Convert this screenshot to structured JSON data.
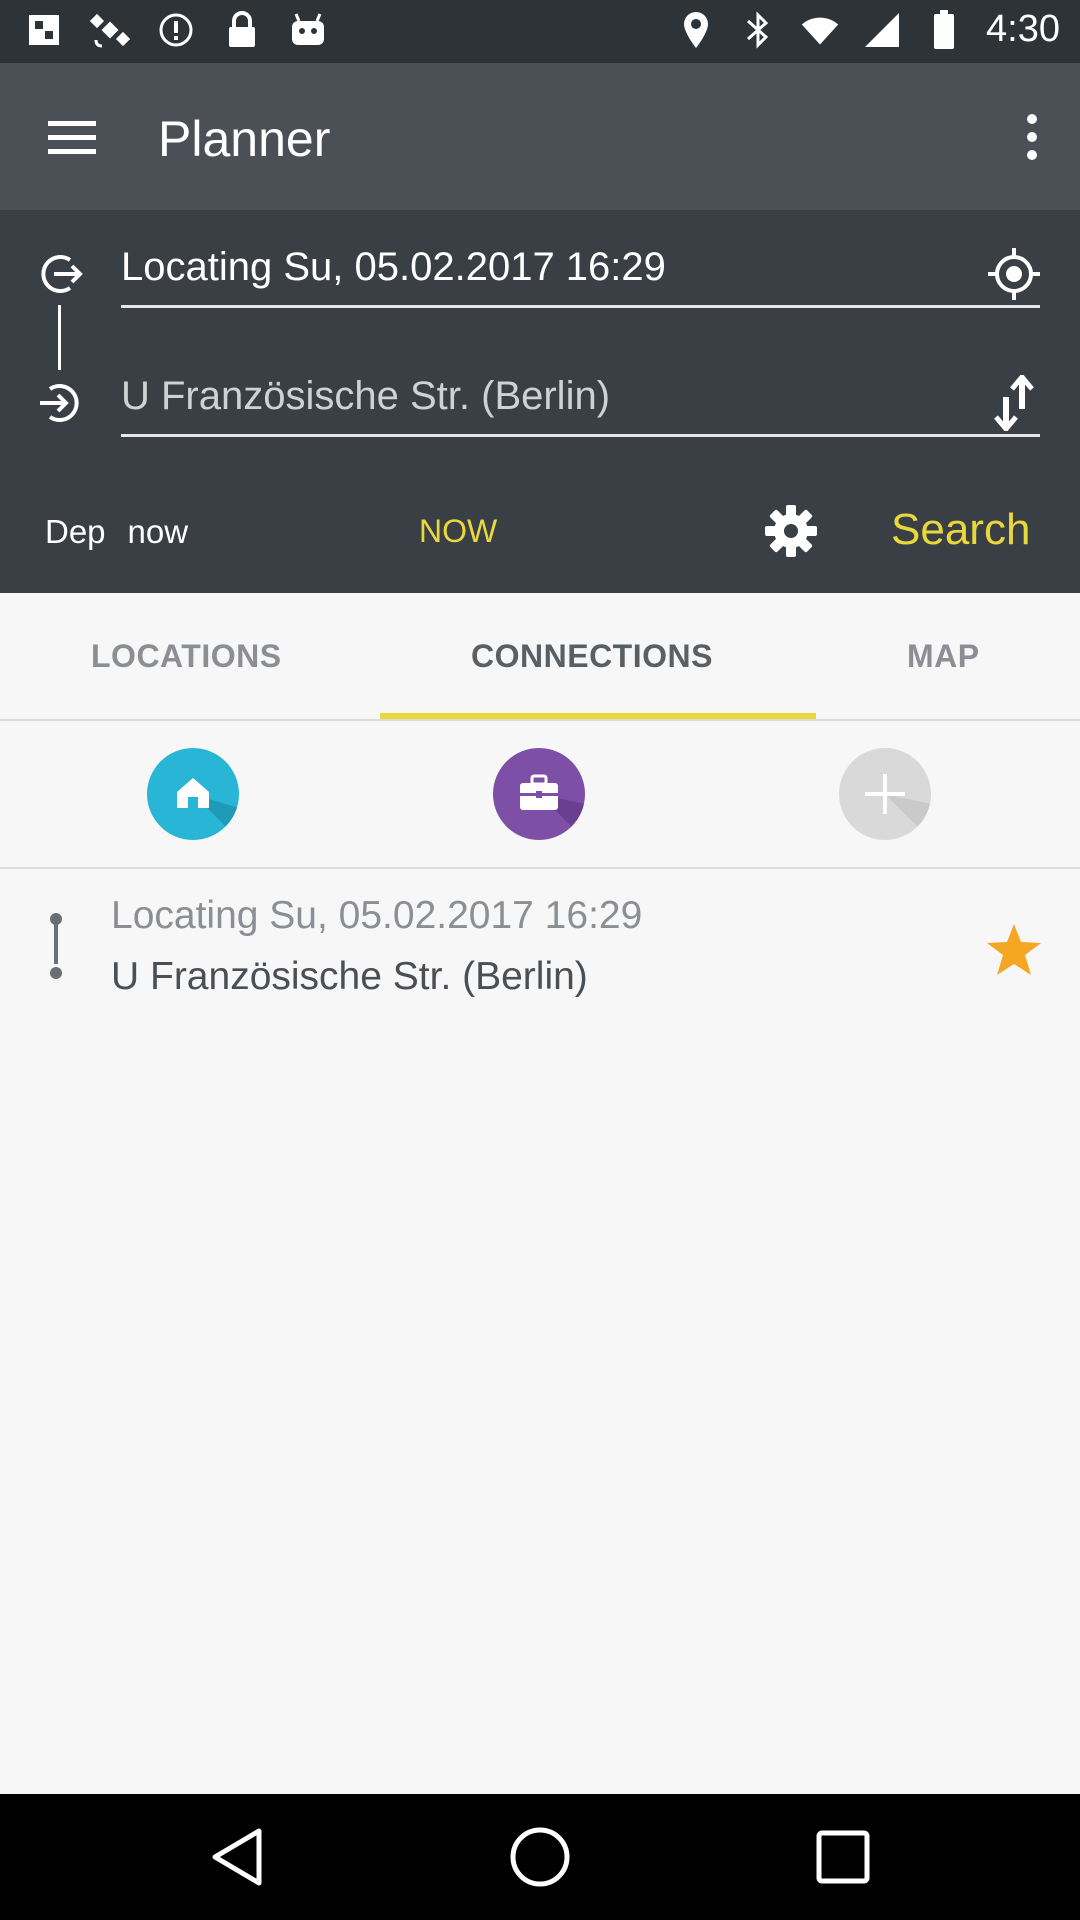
{
  "status_bar": {
    "time": "4:30",
    "left_icons": [
      "fake-gps-icon",
      "satellite-icon",
      "alert-circle-icon",
      "lock-icon",
      "android-icon"
    ],
    "right_icons": [
      "location-icon",
      "bluetooth-icon",
      "wifi-icon",
      "signal-icon",
      "battery-icon"
    ]
  },
  "app_bar": {
    "title": "Planner"
  },
  "planner": {
    "from_value": "Locating Su, 05.02.2017 16:29",
    "to_value": "U Französische Str. (Berlin)",
    "dep_label": "Dep",
    "dep_time": "now",
    "now_button": "NOW",
    "search_button": "Search"
  },
  "tabs": {
    "locations": "LOCATIONS",
    "connections": "CONNECTIONS",
    "map": "MAP",
    "active": "connections"
  },
  "favorites": [
    {
      "icon": "home-icon",
      "color": "#29b6d6"
    },
    {
      "icon": "briefcase-icon",
      "color": "#7e4fa6"
    },
    {
      "icon": "add-icon",
      "color": "#d9d9d9"
    }
  ],
  "connection": {
    "from": "Locating Su, 05.02.2017 16:29",
    "to": "U Französische Str. (Berlin)",
    "starred": true
  },
  "colors": {
    "accent": "#e8d83c",
    "star": "#f5a623",
    "app_bar": "#4a5056",
    "planner_bg": "#3a3f45"
  }
}
